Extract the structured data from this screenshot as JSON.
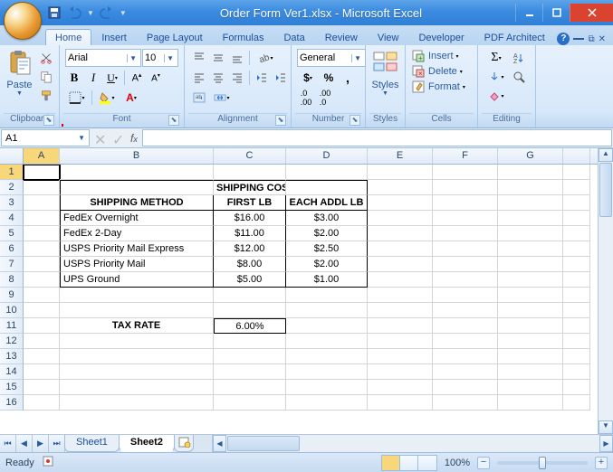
{
  "title": "Order Form Ver1.xlsx - Microsoft Excel",
  "qat": {
    "save": "save",
    "undo": "undo",
    "redo": "redo"
  },
  "tabs": [
    "Home",
    "Insert",
    "Page Layout",
    "Formulas",
    "Data",
    "Review",
    "View",
    "Developer",
    "PDF Architect"
  ],
  "active_tab": 0,
  "ribbon": {
    "clipboard": {
      "label": "Clipboard",
      "paste": "Paste"
    },
    "font": {
      "label": "Font",
      "name": "Arial",
      "size": "10"
    },
    "alignment": {
      "label": "Alignment"
    },
    "number": {
      "label": "Number",
      "format": "General"
    },
    "styles": {
      "label": "Styles",
      "btn": "Styles"
    },
    "cells": {
      "label": "Cells",
      "insert": "Insert",
      "delete": "Delete",
      "format": "Format"
    },
    "editing": {
      "label": "Editing"
    }
  },
  "namebox": "A1",
  "formula": "",
  "columns": [
    "A",
    "B",
    "C",
    "D",
    "E",
    "F",
    "G"
  ],
  "rows": [
    1,
    2,
    3,
    4,
    5,
    6,
    7,
    8,
    9,
    10,
    11,
    12,
    13,
    14,
    15
  ],
  "sel": {
    "row": 1,
    "col": "A"
  },
  "content": {
    "title": "SHIPPING COST",
    "h_method": "SHIPPING METHOD",
    "h_first": "FIRST LB",
    "h_addl": "EACH ADDL LB",
    "r4_b": "FedEx Overnight",
    "r4_c": "$16.00",
    "r4_d": "$3.00",
    "r5_b": "FedEx 2-Day",
    "r5_c": "$11.00",
    "r5_d": "$2.00",
    "r6_b": "USPS Priority Mail Express",
    "r6_c": "$12.00",
    "r6_d": "$2.50",
    "r7_b": "USPS Priority Mail",
    "r7_c": "$8.00",
    "r7_d": "$2.00",
    "r8_b": "UPS Ground",
    "r8_c": "$5.00",
    "r8_d": "$1.00",
    "tax_label": "TAX RATE",
    "tax_val": "6.00%"
  },
  "chart_data": {
    "type": "table",
    "title": "SHIPPING COST",
    "columns": [
      "SHIPPING METHOD",
      "FIRST LB",
      "EACH ADDL LB"
    ],
    "rows": [
      [
        "FedEx Overnight",
        16.0,
        3.0
      ],
      [
        "FedEx 2-Day",
        11.0,
        2.0
      ],
      [
        "USPS Priority Mail Express",
        12.0,
        2.5
      ],
      [
        "USPS Priority Mail",
        8.0,
        2.0
      ],
      [
        "UPS Ground",
        5.0,
        1.0
      ]
    ],
    "extras": {
      "TAX RATE": 0.06
    }
  },
  "sheets": [
    "Sheet1",
    "Sheet2"
  ],
  "active_sheet": 1,
  "status": {
    "mode": "Ready",
    "zoom": "100%"
  }
}
